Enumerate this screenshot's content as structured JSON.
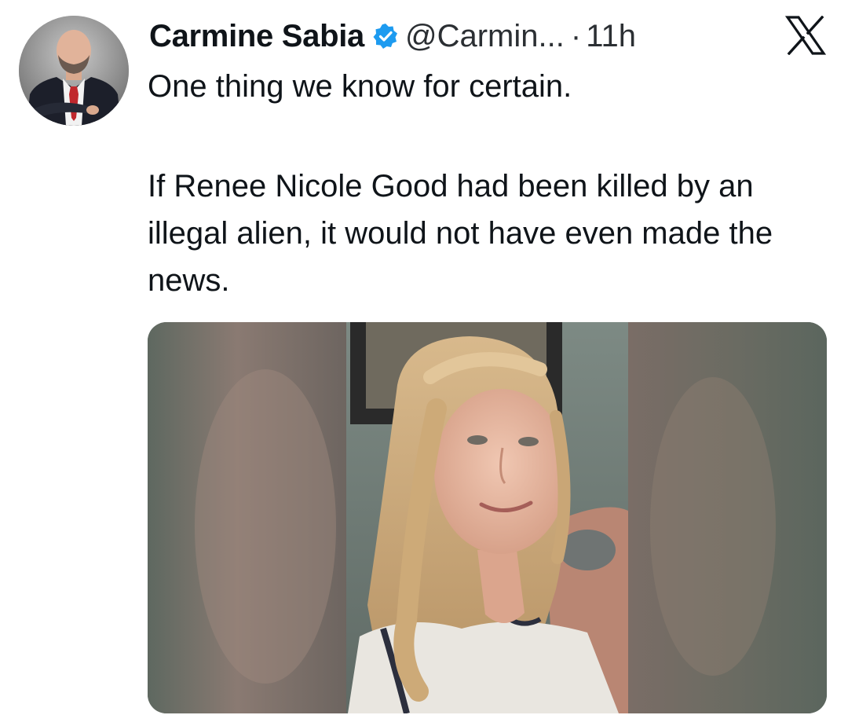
{
  "author": {
    "display_name": "Carmine Sabia",
    "handle": "@Carmin...",
    "verified": true,
    "avatar_icon": "profile-photo-man-suit-red-tie"
  },
  "meta": {
    "separator": "·",
    "time": "11h"
  },
  "platform_logo": "x-logo-icon",
  "tweet": {
    "paragraphs": [
      "One thing we know for certain.",
      "If Renee Nicole Good had been killed by an illegal alien, it would not have even made the news."
    ]
  },
  "media": {
    "icon": "photo-smiling-woman-blonde-hair"
  },
  "colors": {
    "text": "#0f1419",
    "verified_badge": "#1d9bf0",
    "background": "#ffffff"
  }
}
